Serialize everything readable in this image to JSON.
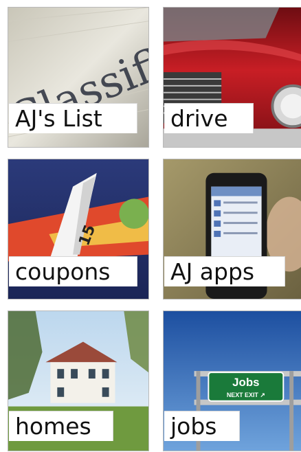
{
  "tiles": [
    {
      "label": "AJ's List"
    },
    {
      "label": "drive"
    },
    {
      "label": "coupons"
    },
    {
      "label": "AJ apps"
    },
    {
      "label": "homes"
    },
    {
      "label": "jobs"
    }
  ],
  "photos": {
    "newspaper_heading": "Classified",
    "coupon_number": "15",
    "sign_title": "Jobs",
    "sign_subtitle": "NEXT EXIT ↗"
  }
}
